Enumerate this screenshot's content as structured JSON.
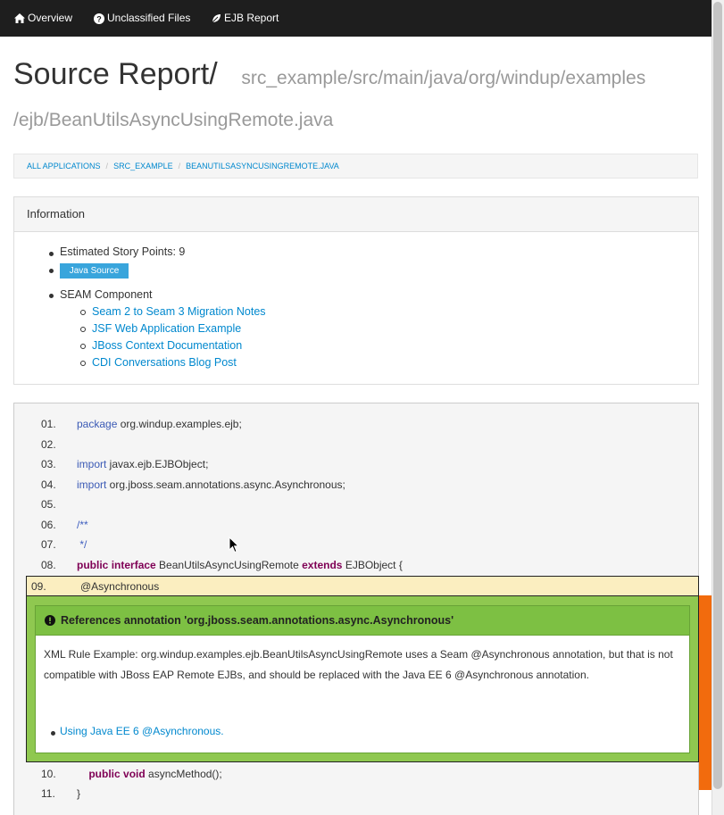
{
  "nav": {
    "items": [
      {
        "label": "Overview",
        "icon": "home-icon"
      },
      {
        "label": "Unclassified Files",
        "icon": "question-circle-icon"
      },
      {
        "label": "EJB Report",
        "icon": "leaf-icon"
      }
    ]
  },
  "header": {
    "title": "Source Report/",
    "path": "src_example/src/main/java/org/windup/examples/ejb/BeanUtilsAsyncUsingRemote.java"
  },
  "breadcrumb": [
    "ALL APPLICATIONS",
    "SRC_EXAMPLE",
    "BEANUTILSASYNCUSINGREMOTE.JAVA"
  ],
  "info": {
    "heading": "Information",
    "story_points": "Estimated Story Points: 9",
    "tag": "Java Source",
    "component": "SEAM Component",
    "links": [
      "Seam 2 to Seam 3 Migration Notes",
      "JSF Web Application Example",
      "JBoss Context Documentation",
      "CDI Conversations Blog Post"
    ]
  },
  "code": {
    "lines": [
      {
        "num": "01.",
        "parts": [
          [
            "kw-blue",
            "package"
          ],
          [
            "plain",
            " org.windup.examples.ejb;"
          ]
        ]
      },
      {
        "num": "02.",
        "parts": []
      },
      {
        "num": "03.",
        "parts": [
          [
            "kw-blue",
            "import"
          ],
          [
            "plain",
            " javax.ejb.EJBObject;"
          ]
        ]
      },
      {
        "num": "04.",
        "parts": [
          [
            "kw-blue",
            "import"
          ],
          [
            "plain",
            " org.jboss.seam.annotations.async.Asynchronous;"
          ]
        ]
      },
      {
        "num": "05.",
        "parts": []
      },
      {
        "num": "06.",
        "parts": [
          [
            "cmt",
            "/**"
          ]
        ]
      },
      {
        "num": "07.",
        "parts": [
          [
            "cmt",
            " */"
          ]
        ]
      },
      {
        "num": "08.",
        "parts": [
          [
            "kw-purple",
            "public"
          ],
          [
            "plain",
            " "
          ],
          [
            "kw-purple",
            "interface"
          ],
          [
            "plain",
            " BeanUtilsAsyncUsingRemote "
          ],
          [
            "kw-purple",
            "extends"
          ],
          [
            "plain",
            " EJBObject {"
          ]
        ]
      }
    ],
    "highlighted": {
      "num": "09.",
      "text": "@Asynchronous"
    },
    "after": [
      {
        "num": "10.",
        "parts": [
          [
            "plain",
            "    "
          ],
          [
            "kw-purple",
            "public"
          ],
          [
            "plain",
            " "
          ],
          [
            "kw-purple",
            "void"
          ],
          [
            "plain",
            " asyncMethod();"
          ]
        ]
      },
      {
        "num": "11.",
        "parts": [
          [
            "plain",
            "}"
          ]
        ]
      }
    ]
  },
  "hint": {
    "title": "References annotation 'org.jboss.seam.annotations.async.Asynchronous'",
    "body": "XML Rule Example: org.windup.examples.ejb.BeanUtilsAsyncUsingRemote uses a Seam @Asynchronous annotation, but that is not compatible with JBoss EAP Remote EJBs, and should be replaced with the Java EE 6 @Asynchronous annotation.",
    "link": "Using Java EE 6 @Asynchronous."
  },
  "colors": {
    "navbar": "#1e1e1e",
    "hint_green": "#7dc043",
    "marker_orange": "#f26b0d",
    "highlight": "#fbeec0"
  }
}
